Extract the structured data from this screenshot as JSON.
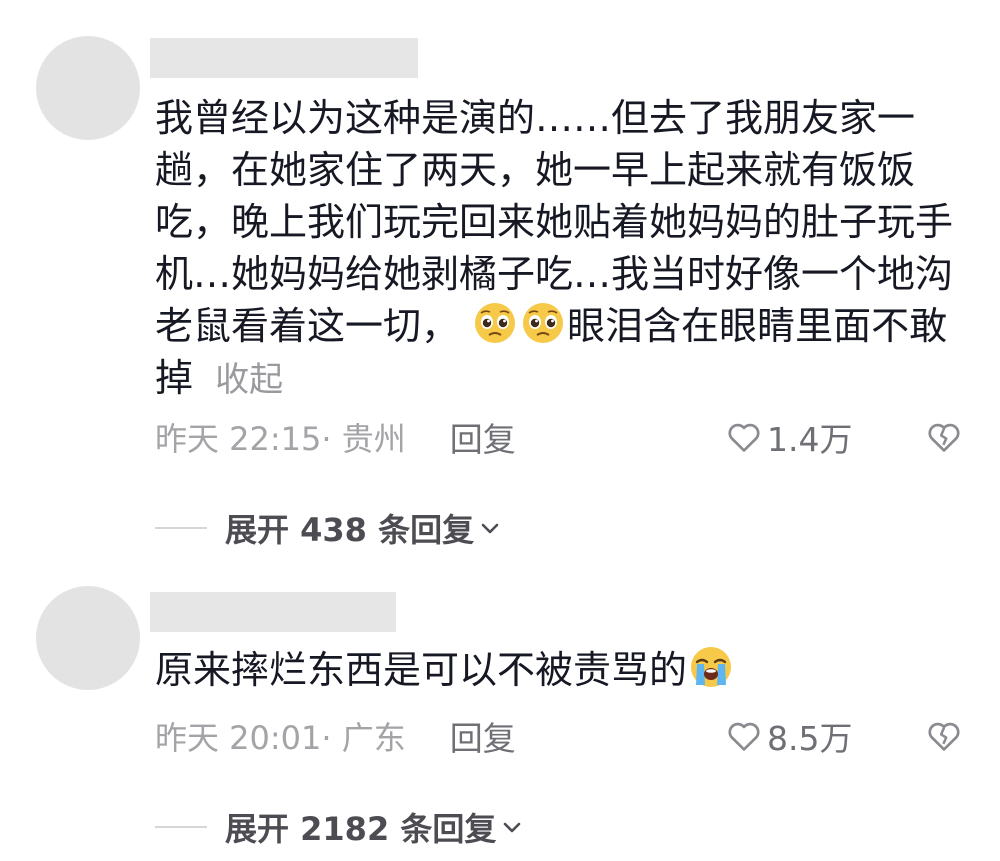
{
  "comments": [
    {
      "text_parts": [
        "我曾经以为这种是演的……但去了我朋友家一趟，在她家住了两天，她一早上起来就有饭饭吃，晚上我们玩完回来她贴着她妈妈的肚子玩手机…她妈妈给她剥橘子吃…我当时好像一个地沟老鼠看着这一切，",
        "眼泪含在眼睛里面不敢掉"
      ],
      "emojis": [
        "pleading-face-emoji",
        "pleading-face-emoji"
      ],
      "collapse_label": "收起",
      "time_location": "昨天 22:15· 贵州",
      "reply_label": "回复",
      "like_count": "1.4万",
      "expand_label": "展开 438 条回复"
    },
    {
      "text_parts": [
        "原来摔烂东西是可以不被责骂的"
      ],
      "emojis": [
        "loudly-crying-face-emoji"
      ],
      "time_location": "昨天 20:01· 广东",
      "reply_label": "回复",
      "like_count": "8.5万",
      "expand_label": "展开 2182 条回复"
    }
  ]
}
